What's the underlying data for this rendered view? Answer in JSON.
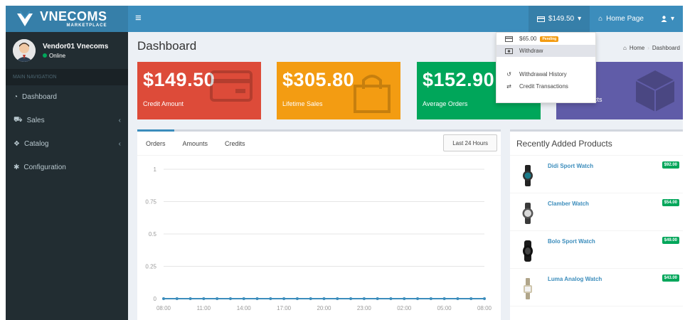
{
  "brand": {
    "name": "VNECOMS",
    "sub": "MARKETPLACE"
  },
  "topbar": {
    "menu_icon": "hamburger-icon",
    "credit_label": "$149.50",
    "home_label": "Home Page",
    "user_icon": "user-icon"
  },
  "sidebar": {
    "user_name": "Vendor01 Vnecoms",
    "user_status": "Online",
    "header": "MAIN NAVIGATION",
    "items": [
      {
        "label": "Dashboard",
        "icon": "dashboard-icon",
        "chevron": ""
      },
      {
        "label": "Sales",
        "icon": "cart-icon",
        "chevron": "‹"
      },
      {
        "label": "Catalog",
        "icon": "cubes-icon",
        "chevron": "‹"
      },
      {
        "label": "Configuration",
        "icon": "gear-icon",
        "chevron": ""
      }
    ]
  },
  "page": {
    "title": "Dashboard"
  },
  "breadcrumb": {
    "home": "Home",
    "current": "Dashboard"
  },
  "stats": [
    {
      "value": "$149.50",
      "label": "Credit Amount",
      "color": "#dd4b39"
    },
    {
      "value": "$305.80",
      "label": "Lifetime Sales",
      "color": "#f39c12"
    },
    {
      "value": "$152.90",
      "label": "Average Orders",
      "color": "#00a65a"
    },
    {
      "value": "",
      "label": "ucts",
      "color": "#605ca8"
    }
  ],
  "chart_tabs": {
    "orders": "Orders",
    "amounts": "Amounts",
    "credits": "Credits",
    "range": "Last 24 Hours"
  },
  "chart_data": {
    "type": "line",
    "x_ticks": [
      "08:00",
      "11:00",
      "14:00",
      "17:00",
      "20:00",
      "23:00",
      "02:00",
      "05:00",
      "08:00"
    ],
    "y_ticks": [
      "0",
      "0.25",
      "0.5",
      "0.75",
      "1"
    ],
    "ylim": [
      0,
      1
    ],
    "series": [
      {
        "values": [
          0,
          0,
          0,
          0,
          0,
          0,
          0,
          0,
          0,
          0,
          0,
          0,
          0,
          0,
          0,
          0,
          0,
          0,
          0,
          0,
          0,
          0,
          0,
          0,
          0
        ],
        "color": "#3c8dbc"
      }
    ],
    "grid": true
  },
  "products": {
    "title": "Recently Added Products",
    "items": [
      {
        "name": "Didi Sport Watch",
        "price": "$92.00"
      },
      {
        "name": "Clamber Watch",
        "price": "$54.00"
      },
      {
        "name": "Bolo Sport Watch",
        "price": "$49.00"
      },
      {
        "name": "Luma Analog Watch",
        "price": "$43.00"
      }
    ]
  },
  "dropdown": {
    "pending_amount": "$65.00",
    "pending_badge": "Pending",
    "withdraw": "Withdraw",
    "history": "Withdrawal History",
    "transactions": "Credit Transactions"
  }
}
